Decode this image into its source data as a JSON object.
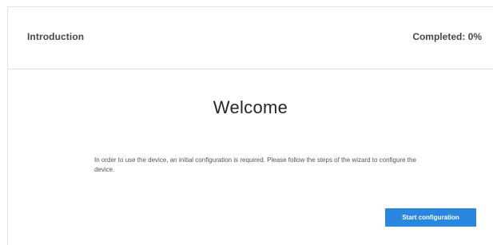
{
  "header": {
    "step_title": "Introduction",
    "progress_label": "Completed: 0%"
  },
  "main": {
    "heading": "Welcome",
    "description": "In order to use the device, an initial configuration is required. Please follow the steps of the wizard to configure the device.",
    "start_button_label": "Start configuration"
  },
  "colors": {
    "accent": "#2a87e0",
    "divider": "#dcdcdc"
  }
}
